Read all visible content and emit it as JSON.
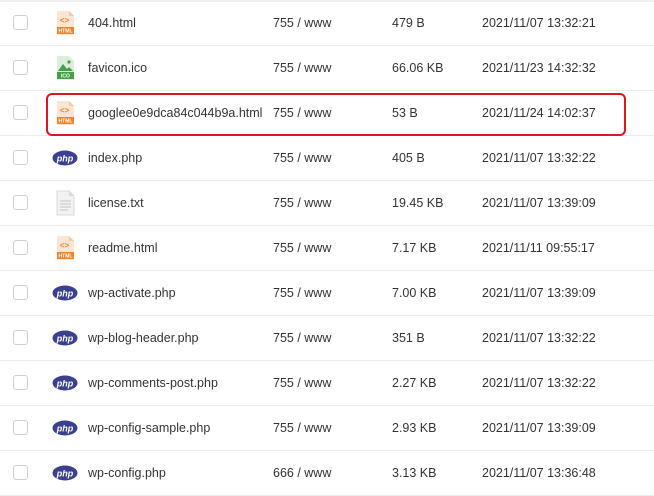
{
  "files": [
    {
      "name": "404.html",
      "permissions": "755 / www",
      "size": "479 B",
      "modified": "2021/11/07 13:32:21",
      "type": "html",
      "icon": "html-file-icon",
      "icon_label": "HTML"
    },
    {
      "name": "favicon.ico",
      "permissions": "755 / www",
      "size": "66.06 KB",
      "modified": "2021/11/23 14:32:32",
      "type": "ico",
      "icon": "image-file-icon",
      "icon_label": "ICO"
    },
    {
      "name": "googlee0e9dca84c044b9a.html",
      "permissions": "755 / www",
      "size": "53 B",
      "modified": "2021/11/24 14:02:37",
      "type": "html",
      "icon": "html-file-icon",
      "icon_label": "HTML",
      "highlighted": true
    },
    {
      "name": "index.php",
      "permissions": "755 / www",
      "size": "405 B",
      "modified": "2021/11/07 13:32:22",
      "type": "php",
      "icon": "php-file-icon",
      "icon_label": "php"
    },
    {
      "name": "license.txt",
      "permissions": "755 / www",
      "size": "19.45 KB",
      "modified": "2021/11/07 13:39:09",
      "type": "txt",
      "icon": "text-file-icon",
      "icon_label": ""
    },
    {
      "name": "readme.html",
      "permissions": "755 / www",
      "size": "7.17 KB",
      "modified": "2021/11/11 09:55:17",
      "type": "html",
      "icon": "html-file-icon",
      "icon_label": "HTML"
    },
    {
      "name": "wp-activate.php",
      "permissions": "755 / www",
      "size": "7.00 KB",
      "modified": "2021/11/07 13:39:09",
      "type": "php",
      "icon": "php-file-icon",
      "icon_label": "php"
    },
    {
      "name": "wp-blog-header.php",
      "permissions": "755 / www",
      "size": "351 B",
      "modified": "2021/11/07 13:32:22",
      "type": "php",
      "icon": "php-file-icon",
      "icon_label": "php"
    },
    {
      "name": "wp-comments-post.php",
      "permissions": "755 / www",
      "size": "2.27 KB",
      "modified": "2021/11/07 13:32:22",
      "type": "php",
      "icon": "php-file-icon",
      "icon_label": "php"
    },
    {
      "name": "wp-config-sample.php",
      "permissions": "755 / www",
      "size": "2.93 KB",
      "modified": "2021/11/07 13:39:09",
      "type": "php",
      "icon": "php-file-icon",
      "icon_label": "php"
    },
    {
      "name": "wp-config.php",
      "permissions": "666 / www",
      "size": "3.13 KB",
      "modified": "2021/11/07 13:36:48",
      "type": "php",
      "icon": "php-file-icon",
      "icon_label": "php"
    }
  ],
  "colors": {
    "highlight_border": "#e0141e",
    "html_icon": "#f0822a",
    "ico_icon": "#43a047",
    "php_icon": "#3a3f8f",
    "txt_icon": "#d9d9d9"
  }
}
